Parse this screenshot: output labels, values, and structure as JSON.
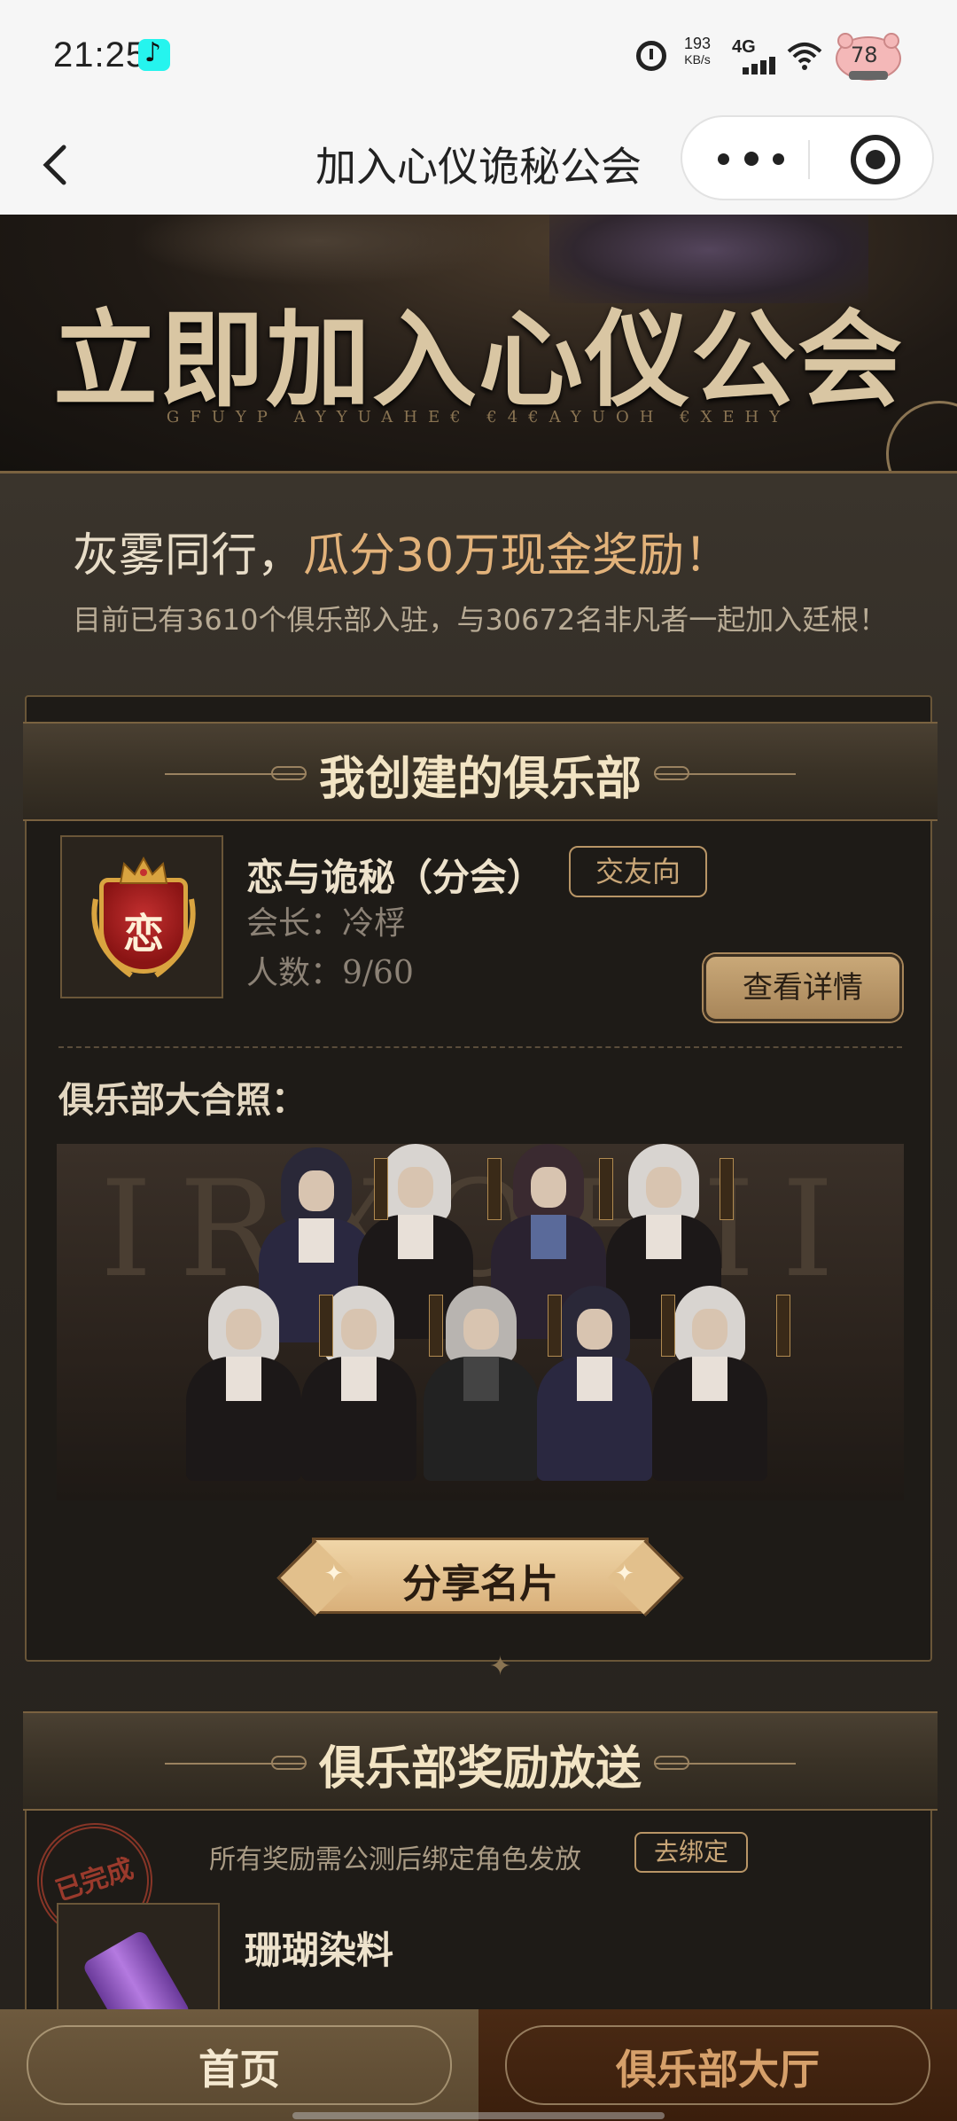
{
  "status_bar": {
    "time": "21:25",
    "net_speed_value": "193",
    "net_speed_unit": "KB/s",
    "network": "4G",
    "battery": "78",
    "icons": [
      "tiktok-icon",
      "alarm-icon",
      "signal-icon",
      "wifi-icon",
      "battery-icon"
    ]
  },
  "nav": {
    "title": "加入心仪诡秘公会",
    "icons": [
      "back-icon",
      "more-icon",
      "target-icon"
    ]
  },
  "hero": {
    "title": "立即加入心仪公会",
    "subtitle": "GFUYP AYYUAHE€ €4€AYUOH €XEHY"
  },
  "intro": {
    "slogan_prefix": "灰雾同行，",
    "slogan_highlight": "瓜分30万现金奖励！",
    "stats": "目前已有3610个俱乐部入驻，与30672名非凡者一起加入廷根！"
  },
  "my_club": {
    "section_title": "我创建的俱乐部",
    "badge_char": "恋",
    "name": "恋与诡秘（分会）",
    "tag": "交友向",
    "leader": "会长：冷桴",
    "members": "人数：9/60",
    "detail_button": "查看详情",
    "photo_label": "俱乐部大合照：",
    "photo_bg_text": "IRXOHII",
    "share_button": "分享名片"
  },
  "rewards": {
    "section_title": "俱乐部奖励放送",
    "note": "所有奖励需公测后绑定角色发放",
    "bind_button": "去绑定",
    "stamp": "已完成",
    "item_name": "珊瑚染料"
  },
  "bottom_tabs": {
    "home": "首页",
    "hall": "俱乐部大厅"
  },
  "colors": {
    "accent": "#e2b27a",
    "gold": "#c9a677",
    "background": "#1c1a17"
  }
}
